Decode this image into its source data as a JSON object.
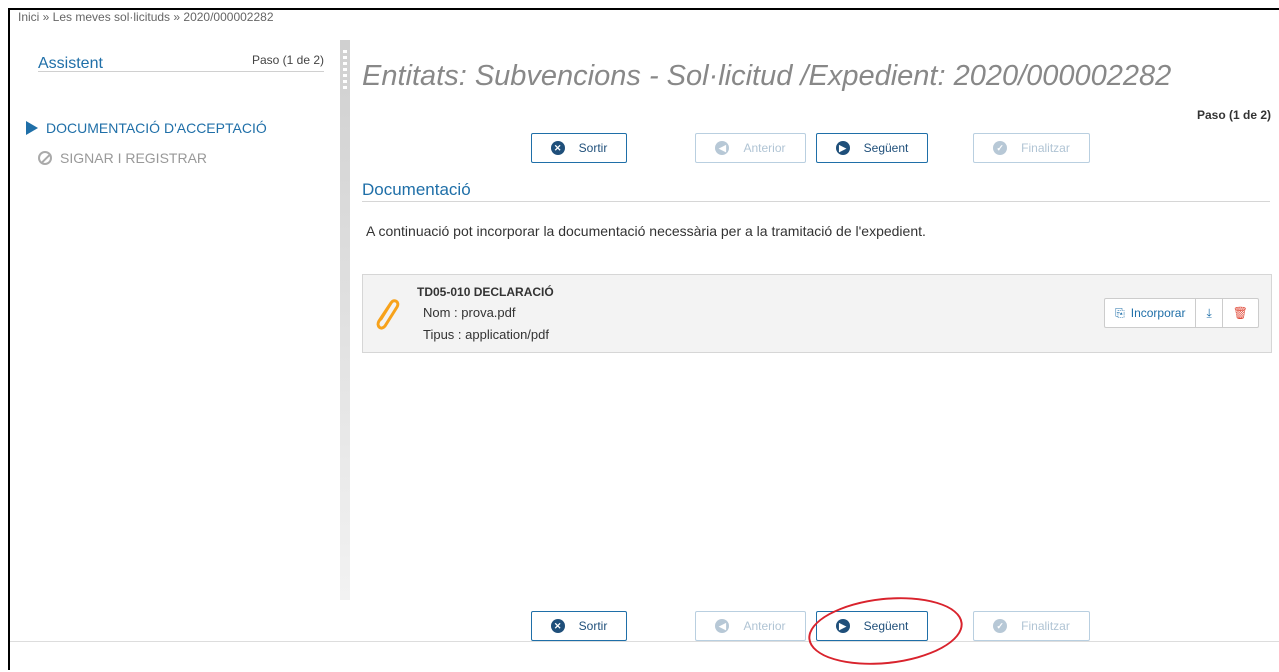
{
  "breadcrumb": "Inici » Les meves sol·licituds » 2020/000002282",
  "sidebar": {
    "title": "Assistent",
    "step": "Paso (1 de 2)",
    "items": [
      {
        "label": "DOCUMENTACIÓ D'ACCEPTACIÓ",
        "state": "active"
      },
      {
        "label": "SIGNAR I REGISTRAR",
        "state": "disabled"
      }
    ]
  },
  "page": {
    "title": "Entitats: Subvencions - Sol·licitud /Expedient: 2020/000002282",
    "step": "Paso (1 de 2)"
  },
  "buttons": {
    "exit": "Sortir",
    "previous": "Anterior",
    "next": "Següent",
    "finish": "Finalitzar"
  },
  "section": {
    "title": "Documentació",
    "intro": "A continuació pot incorporar la documentació necessària per a la tramitació de l'expedient."
  },
  "document": {
    "code": "TD05-010 DECLARACIÓ",
    "name": "Nom : prova.pdf",
    "type": "Tipus : application/pdf",
    "incorporate_label": "Incorporar"
  },
  "colors": {
    "accent": "#1f6fa8",
    "highlight": "#d9232d",
    "clip": "#f7a21b"
  }
}
